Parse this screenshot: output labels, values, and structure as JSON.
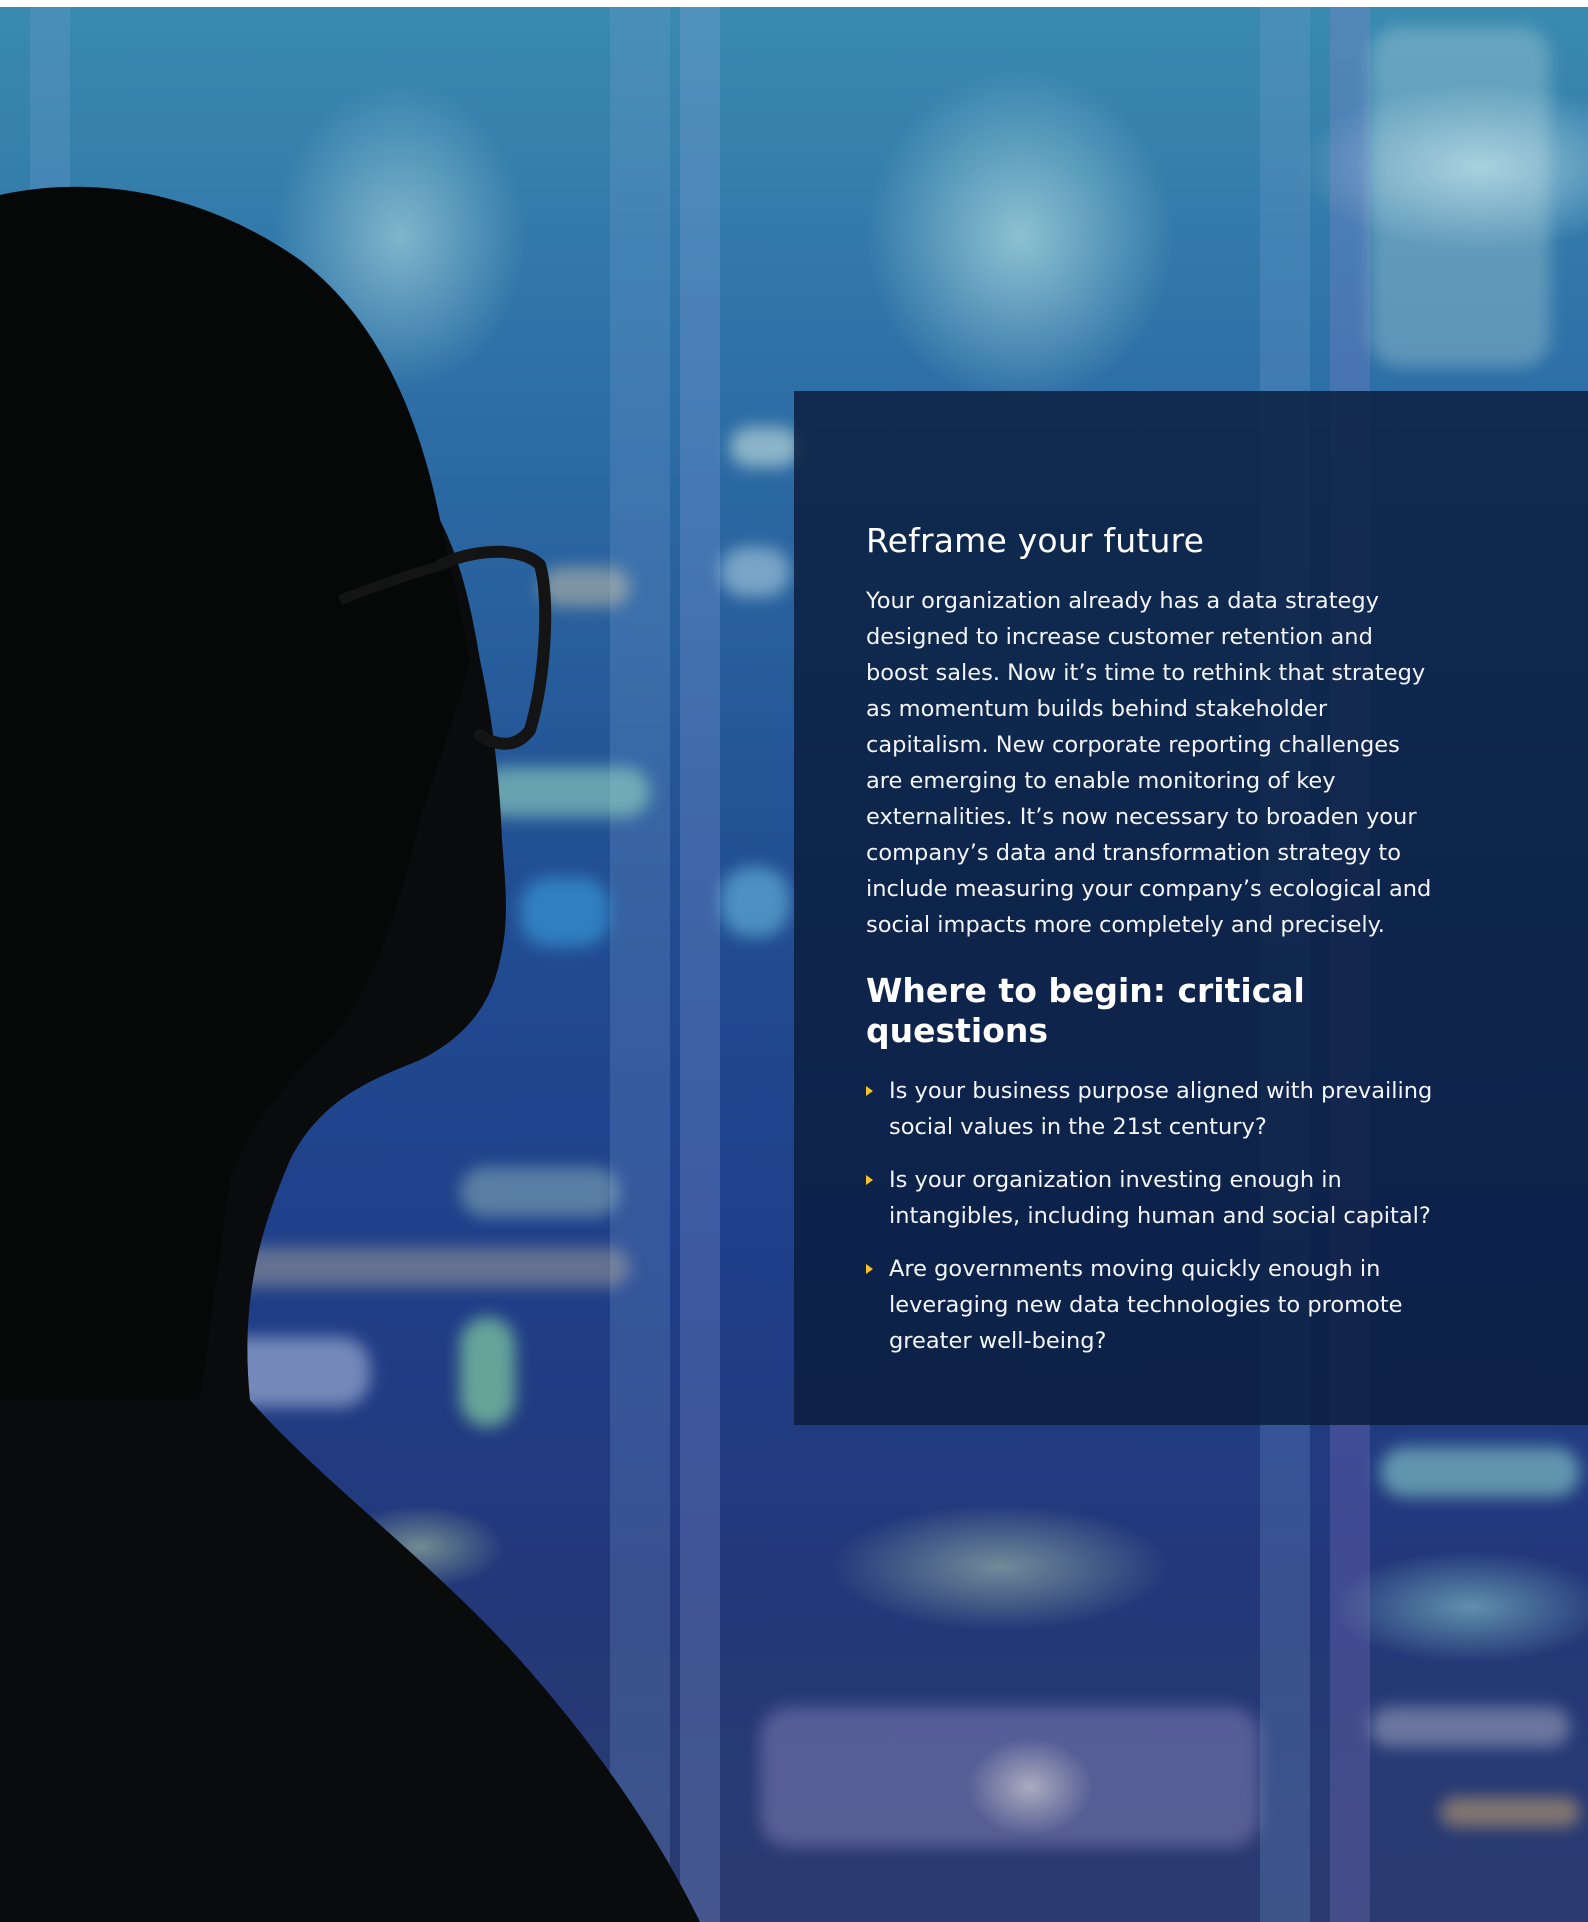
{
  "section": {
    "title": "Reframe your future",
    "body": "Your organization already has a data strategy designed to increase customer retention and boost sales. Now it’s time to rethink that strategy as momentum builds behind stakeholder capitalism. New corporate reporting challenges are emerging to enable monitoring of key externalities. It’s now necessary to broaden your company’s data and transformation strategy to include measuring your company’s ecological and social impacts more completely and precisely."
  },
  "questions_section": {
    "title": "Where to begin: critical questions",
    "items": [
      {
        "text": "Is your business purpose aligned with prevailing social values in the 21st century?"
      },
      {
        "text": "Is your organization investing enough in intangibles, including human and social capital?"
      },
      {
        "text": "Are governments moving quickly enough in leveraging new data technologies to promote greater well-being?"
      }
    ]
  },
  "colors": {
    "panel_bg": "#0a1c3c",
    "bullet": "#f6c523",
    "text": "#ffffff"
  },
  "icons": {
    "bullet": "triangle-right-icon"
  }
}
